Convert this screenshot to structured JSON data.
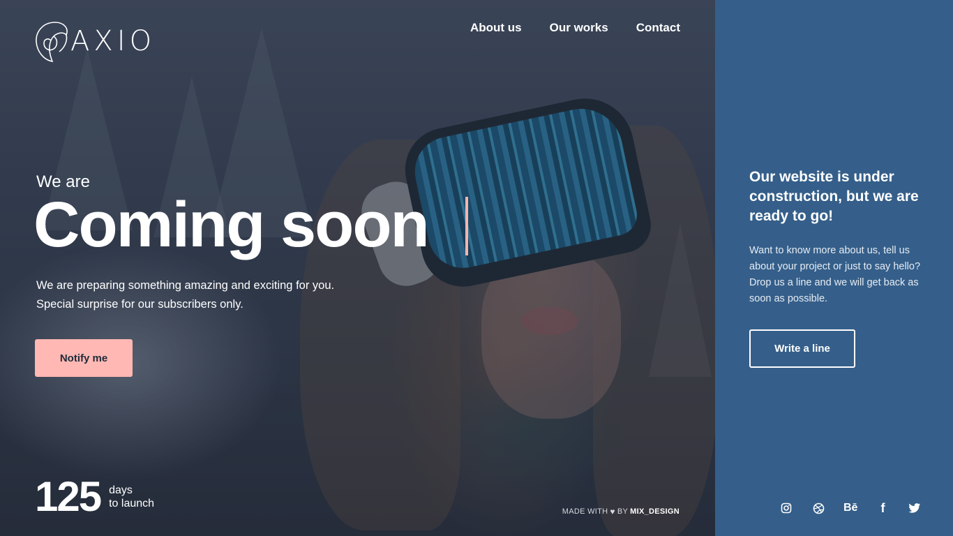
{
  "brand": {
    "logo_text": "AXIO"
  },
  "nav": {
    "items": [
      "About us",
      "Our works",
      "Contact"
    ]
  },
  "hero": {
    "eyebrow": "We are",
    "headline": "Coming soon",
    "subtitle_line1": "We are preparing something amazing and exciting for you.",
    "subtitle_line2": "Special surprise for our subscribers only.",
    "cta_label": "Notify me"
  },
  "countdown": {
    "number": "125",
    "label_line1": "days",
    "label_line2": "to launch"
  },
  "credit": {
    "prefix": "MADE WITH",
    "middle": "BY",
    "author": "MIX_DESIGN"
  },
  "panel": {
    "title": "Our website is under construction, but we are ready to go!",
    "text": "Want to know more about us, tell us about your project or just to say hello? Drop us a line and we will get back as soon as possible.",
    "button_label": "Write a line"
  },
  "social": {
    "icons": [
      "instagram-icon",
      "dribbble-icon",
      "behance-icon",
      "facebook-icon",
      "twitter-icon"
    ],
    "behance_text": "Bē",
    "facebook_text": "f"
  },
  "colors": {
    "accent_pink": "#ffb8b3",
    "panel_blue": "#355f8a",
    "text_white": "#ffffff"
  }
}
